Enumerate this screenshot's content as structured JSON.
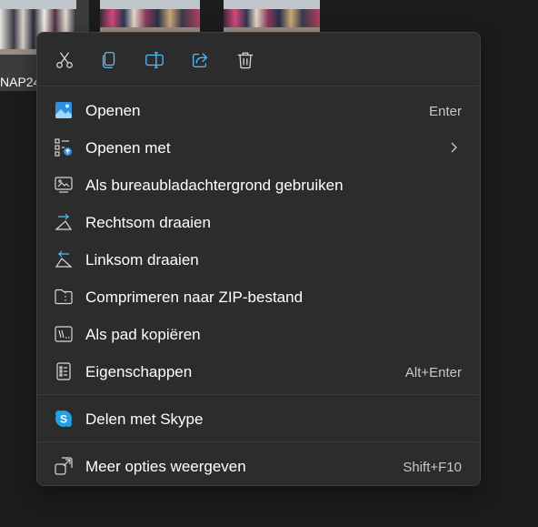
{
  "background": {
    "file_name": "NAP24"
  },
  "toolbar": {
    "icons": [
      "cut-icon",
      "copy-icon",
      "rename-icon",
      "share-icon",
      "delete-icon"
    ]
  },
  "menu": {
    "items": [
      {
        "label": "Openen",
        "shortcut": "Enter",
        "icon": "image-icon"
      },
      {
        "label": "Openen met",
        "shortcut": "",
        "icon": "open-with-icon",
        "submenu": true
      },
      {
        "label": "Als bureaubladachtergrond gebruiken",
        "shortcut": "",
        "icon": "wallpaper-icon"
      },
      {
        "label": "Rechtsom draaien",
        "shortcut": "",
        "icon": "rotate-right-icon"
      },
      {
        "label": "Linksom draaien",
        "shortcut": "",
        "icon": "rotate-left-icon"
      },
      {
        "label": "Comprimeren naar ZIP-bestand",
        "shortcut": "",
        "icon": "zip-folder-icon"
      },
      {
        "label": "Als pad kopiëren",
        "shortcut": "",
        "icon": "copy-path-icon"
      },
      {
        "label": "Eigenschappen",
        "shortcut": "Alt+Enter",
        "icon": "properties-icon"
      },
      {
        "label": "Delen met Skype",
        "shortcut": "",
        "icon": "skype-icon"
      },
      {
        "label": "Meer opties weergeven",
        "shortcut": "Shift+F10",
        "icon": "more-options-icon"
      }
    ]
  },
  "colors": {
    "menu_bg": "#2c2c2c",
    "accent": "#4cc2ff",
    "skype": "#1fa3e8",
    "text": "#ffffff",
    "shortcut_text": "#c8c8c8"
  }
}
